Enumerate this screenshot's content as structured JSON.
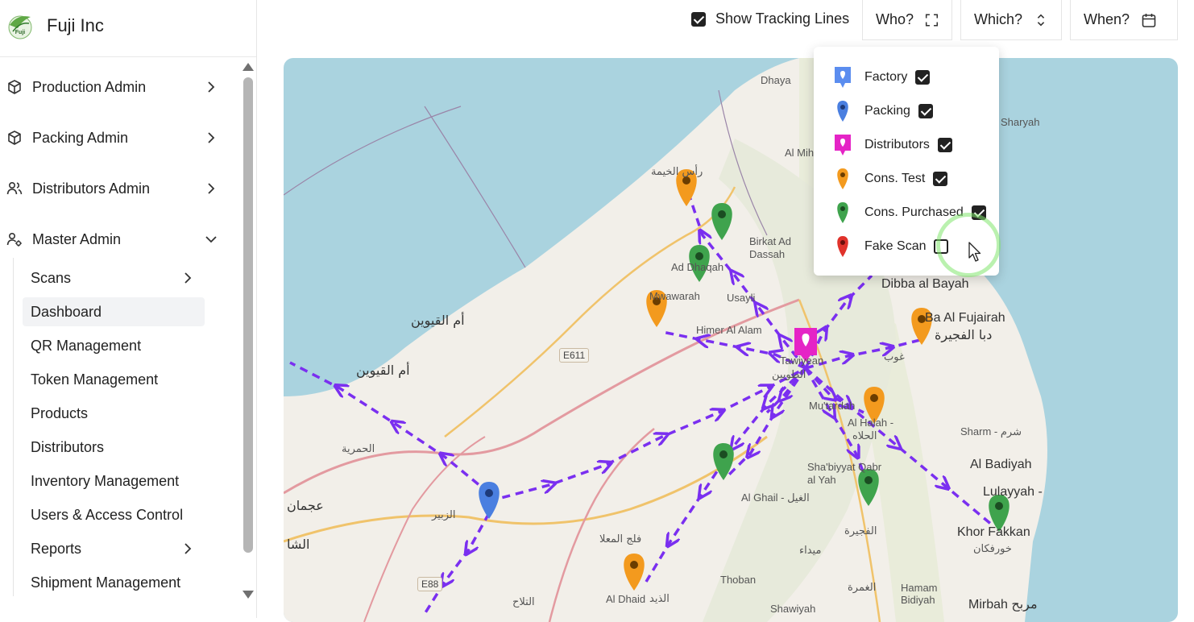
{
  "app": {
    "name": "Fuji Inc",
    "logo_text": "Fuji"
  },
  "sidebar": {
    "items": [
      {
        "label": "Production Admin",
        "icon": "box-icon",
        "expanded": false
      },
      {
        "label": "Packing Admin",
        "icon": "box-icon",
        "expanded": false
      },
      {
        "label": "Distributors Admin",
        "icon": "users-icon",
        "expanded": false
      },
      {
        "label": "Master Admin",
        "icon": "user-gear-icon",
        "expanded": true
      }
    ],
    "sub_items": [
      {
        "label": "Scans",
        "has_children": true
      },
      {
        "label": "Dashboard",
        "active": true
      },
      {
        "label": "QR Management"
      },
      {
        "label": "Token Management"
      },
      {
        "label": "Products"
      },
      {
        "label": "Distributors"
      },
      {
        "label": "Inventory Management"
      },
      {
        "label": "Users & Access Control"
      },
      {
        "label": "Reports",
        "has_children": true
      },
      {
        "label": "Shipment Management"
      }
    ]
  },
  "toolbar": {
    "show_tracking_lines": {
      "label": "Show Tracking Lines",
      "checked": true
    },
    "who": {
      "label": "Who?",
      "icon": "expand-icon"
    },
    "which": {
      "label": "Which?",
      "icon": "chevron-up-down-icon"
    },
    "when": {
      "label": "When?",
      "icon": "calendar-icon"
    }
  },
  "legend_dropdown": {
    "items": [
      {
        "label": "Factory",
        "color": "#5b8def",
        "checked": true
      },
      {
        "label": "Packing",
        "color": "#4a7fe0",
        "checked": true
      },
      {
        "label": "Distributors",
        "color": "#e524c6",
        "checked": true
      },
      {
        "label": "Cons. Test",
        "color": "#f39a1e",
        "checked": true
      },
      {
        "label": "Cons. Purchased",
        "color": "#3fa34d",
        "checked": true
      },
      {
        "label": "Fake Scan",
        "color": "#e0322b",
        "checked": false
      }
    ]
  },
  "map": {
    "labels": {
      "dhaya": "Dhaya",
      "al_miher": "Al Miher",
      "sharyah": "Sharyah",
      "birkat": "Birkat Ad Dassah",
      "ad_dhaid_top": "Ad Dhaqah",
      "wawarah": "Mwawarah",
      "usayli": "Usayli",
      "himer": "Himer Al Alam",
      "tawiyean": "Tawiyean",
      "dibba": "Dibba al Bayah",
      "fujairah_en": "Ba Al Fujairah",
      "mutardah": "Mu'tardah",
      "al_halah": "Al Halah -",
      "sharm": "Sharm - شرم",
      "al_badiyah": "Al Badiyah",
      "lulayyah": "Lulayyah -",
      "khor_fakkan": "Khor Fakkan",
      "shabiyyat": "Sha'biyyat Qabr al Yah",
      "al_ghail": "Al Ghail - الغيل",
      "thoban": "Thoban",
      "al_dhaid": "Al Dhaid",
      "shawiyah": "Shawiyah",
      "mirbah": "Mirbah مربح",
      "hamam": "Hamam Bidiyah",
      "um_al_quwain": "أم القيوين",
      "um_al_quwain2": "أم القيوين",
      "ajman": "عجمان",
      "alhamriya": "الحمرية",
      "falaj": "فلج المعلا",
      "altalah": "التلاح",
      "alzubair": "الزبير",
      "fujairah_ar": "دبا الفجيرة",
      "ghub": "غوب",
      "khorfakkan_ar": "خورفكان",
      "shaam": "الشا",
      "ras_al_khaimah": "رأس الخيمة",
      "alghail_ar": "الغيل",
      "mida": "ميداء",
      "aldhaid_ar": "الذيد",
      "fujairah2_ar": "الفجيرة",
      "alghamra": "الغمرة",
      "alkhakhrah": "الحلاه",
      "dibba_ar": "الطويين"
    },
    "road_shields": {
      "e611": "E611",
      "e88": "E88"
    },
    "colors": {
      "water": "#aad3df",
      "land": "#f2efe9",
      "tracking_line": "#7a2ff0"
    }
  }
}
